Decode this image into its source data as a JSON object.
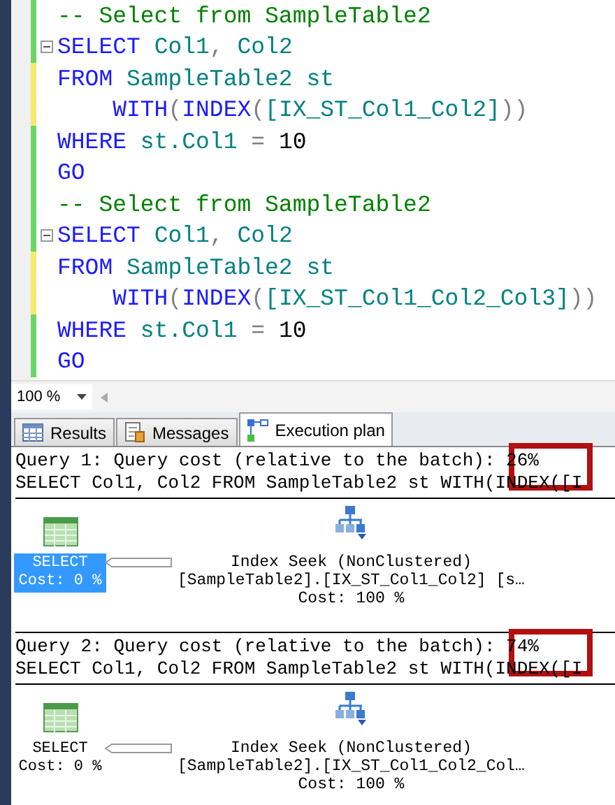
{
  "editor": {
    "lines": [
      {
        "modified": false,
        "fold": false,
        "tokens": [
          {
            "kind": "comment",
            "text": "-- Select from SampleTable2"
          }
        ]
      },
      {
        "modified": false,
        "fold": true,
        "tokens": [
          {
            "kind": "keyword",
            "text": "SELECT"
          },
          {
            "kind": "ident",
            "text": " Col1"
          },
          {
            "kind": "punct",
            "text": ","
          },
          {
            "kind": "ident",
            "text": " Col2"
          }
        ]
      },
      {
        "modified": true,
        "fold": false,
        "tokens": [
          {
            "kind": "keyword",
            "text": "FROM"
          },
          {
            "kind": "ident",
            "text": " SampleTable2 st"
          }
        ]
      },
      {
        "modified": true,
        "fold": false,
        "tokens": [
          {
            "kind": "keyword",
            "text": "    WITH"
          },
          {
            "kind": "punct",
            "text": "("
          },
          {
            "kind": "keyword",
            "text": "INDEX"
          },
          {
            "kind": "punct",
            "text": "("
          },
          {
            "kind": "ident",
            "text": "[IX_ST_Col1_Col2]"
          },
          {
            "kind": "punct",
            "text": "))"
          }
        ]
      },
      {
        "modified": false,
        "fold": false,
        "tokens": [
          {
            "kind": "keyword",
            "text": "WHERE"
          },
          {
            "kind": "ident",
            "text": " st.Col1"
          },
          {
            "kind": "punct",
            "text": " = "
          },
          {
            "kind": "number",
            "text": "10"
          }
        ]
      },
      {
        "modified": false,
        "fold": false,
        "tokens": [
          {
            "kind": "keyword",
            "text": "GO"
          }
        ]
      },
      {
        "modified": false,
        "fold": false,
        "tokens": [
          {
            "kind": "comment",
            "text": "-- Select from SampleTable2"
          }
        ]
      },
      {
        "modified": false,
        "fold": true,
        "tokens": [
          {
            "kind": "keyword",
            "text": "SELECT"
          },
          {
            "kind": "ident",
            "text": " Col1"
          },
          {
            "kind": "punct",
            "text": ","
          },
          {
            "kind": "ident",
            "text": " Col2"
          }
        ]
      },
      {
        "modified": true,
        "fold": false,
        "tokens": [
          {
            "kind": "keyword",
            "text": "FROM"
          },
          {
            "kind": "ident",
            "text": " SampleTable2 st"
          }
        ]
      },
      {
        "modified": true,
        "fold": false,
        "tokens": [
          {
            "kind": "keyword",
            "text": "    WITH"
          },
          {
            "kind": "punct",
            "text": "("
          },
          {
            "kind": "keyword",
            "text": "INDEX"
          },
          {
            "kind": "punct",
            "text": "("
          },
          {
            "kind": "ident",
            "text": "[IX_ST_Col1_Col2_Col3]"
          },
          {
            "kind": "punct",
            "text": "))"
          }
        ]
      },
      {
        "modified": false,
        "fold": false,
        "tokens": [
          {
            "kind": "keyword",
            "text": "WHERE"
          },
          {
            "kind": "ident",
            "text": " st.Col1"
          },
          {
            "kind": "punct",
            "text": " = "
          },
          {
            "kind": "number",
            "text": "10"
          }
        ]
      },
      {
        "modified": false,
        "fold": false,
        "tokens": [
          {
            "kind": "keyword",
            "text": "GO"
          }
        ]
      }
    ]
  },
  "zoom": {
    "value": "100 %"
  },
  "tabs": [
    {
      "label": "Results",
      "selected": false
    },
    {
      "label": "Messages",
      "selected": false
    },
    {
      "label": "Execution plan",
      "selected": true
    }
  ],
  "queries": [
    {
      "header": "Query 1: Query cost (relative to the batch): 26%",
      "sql": "SELECT Col1, Col2 FROM SampleTable2 st WITH(INDEX([I",
      "highlight": true,
      "select": {
        "label": "SELECT",
        "cost": "Cost: 0 %",
        "selected": true
      },
      "seek": {
        "title": "Index Seek (NonClustered)",
        "object": "[SampleTable2].[IX_ST_Col1_Col2] [s…",
        "cost": "Cost: 100 %"
      }
    },
    {
      "header": "Query 2: Query cost (relative to the batch): 74%",
      "sql": "SELECT Col1, Col2 FROM SampleTable2 st WITH(INDEX([I",
      "highlight": true,
      "select": {
        "label": "SELECT",
        "cost": "Cost: 0 %",
        "selected": false
      },
      "seek": {
        "title": "Index Seek (NonClustered)",
        "object": "[SampleTable2].[IX_ST_Col1_Col2_Col…",
        "cost": "Cost: 100 %"
      }
    }
  ]
}
